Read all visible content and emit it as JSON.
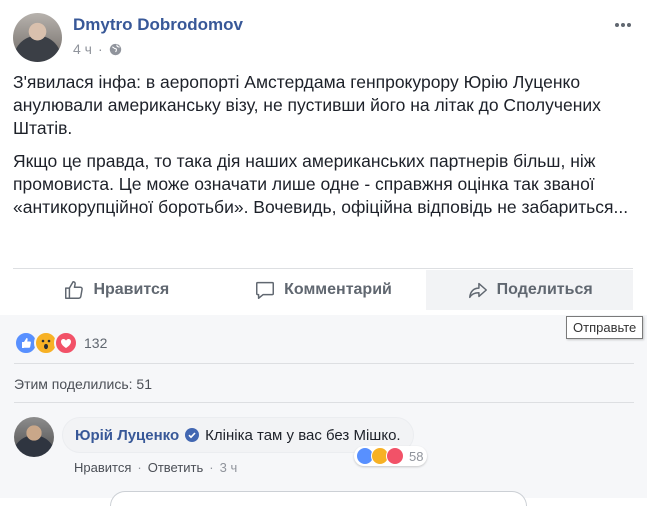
{
  "post": {
    "author": "Dmytro Dobrodomov",
    "time": "4 ч",
    "paragraphs": [
      "З'явилася інфа: в аеропорті Амстердама генпрокурору Юрію Луценко анулювали американську візу, не пустивши його на літак до Сполучених Штатів.",
      "Якщо це правда, то така дія наших американських партнерів більш, ніж промовиста. Це може означати лише одне - справжня оцінка так званої «антикорупційної боротьби». Вочевидь, офіційна відповідь не забариться..."
    ]
  },
  "actions": {
    "like": "Нравится",
    "comment": "Комментарий",
    "share": "Поделиться"
  },
  "tooltip": "Отправьте",
  "reactions": {
    "count": "132",
    "icons": [
      "like-icon",
      "wow-icon",
      "love-icon"
    ],
    "colors": {
      "like": "#5890ff",
      "wow": "#f7b125",
      "love": "#f25268"
    }
  },
  "shares": "Этим поделились: 51",
  "comment": {
    "author": "Юрій Луценко",
    "text": "Клініка там у вас без Мішко.",
    "reaction_count": "58",
    "reply_label": "Нравится",
    "answer_label": "Ответить",
    "separator": "·",
    "time": "3 ч"
  },
  "colors": {
    "link": "#385898",
    "muted": "#90949c"
  }
}
